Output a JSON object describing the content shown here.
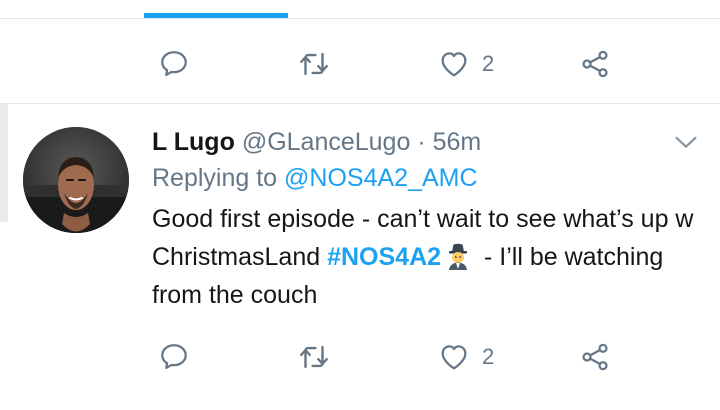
{
  "top_tweet": {
    "actions": {
      "reply_icon": "reply-icon",
      "retweet_icon": "retweet-icon",
      "like_icon": "heart-icon",
      "like_count": "2",
      "share_icon": "share-icon"
    }
  },
  "tweet": {
    "display_name": "L Lugo",
    "handle": "@GLanceLugo",
    "separator": "·",
    "time": "56m",
    "replying_prefix": "Replying to",
    "replying_to": "@NOS4A2_AMC",
    "text_part1": "Good first episode - can’t wait to see what’s up w ChristmasLand",
    "hashtag": "#NOS4A2",
    "emoji": "detective-emoji",
    "text_part2": "- I’ll be watching from the couch",
    "actions": {
      "reply_icon": "reply-icon",
      "retweet_icon": "retweet-icon",
      "like_icon": "heart-icon",
      "like_count": "2",
      "share_icon": "share-icon"
    },
    "menu_icon": "chevron-down-icon"
  },
  "colors": {
    "accent": "#1da1f2",
    "secondary_text": "#657786",
    "primary_text": "#14171a",
    "divider": "#e1e8ed"
  }
}
